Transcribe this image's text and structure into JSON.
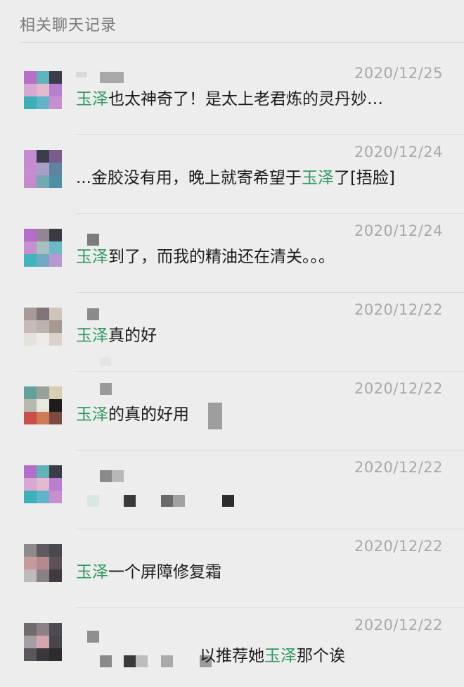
{
  "header": {
    "title": "相关聊天记录"
  },
  "colors": {
    "keyword": "#2f9a5e",
    "date": "#a8a8a8",
    "background": "#ededed"
  },
  "rows": [
    {
      "date": "2020/12/25",
      "keyword": "玉泽",
      "before": "",
      "after": "也太神奇了！是太上老君炼的灵丹妙…",
      "avatar": [
        "#b86fc7",
        "#5fb4b9",
        "#3b3b49",
        "#d7a9d2",
        "#e2b9cf",
        "#b77fcf",
        "#3bb0b6",
        "#5fb4c7",
        "#c78fd0"
      ]
    },
    {
      "date": "2020/12/24",
      "keyword": "玉泽",
      "before": "...金胶没有用，晚上就寄希望于",
      "after": "了[捂脸]",
      "avatar": [
        "#c58bd1",
        "#3b3d4a",
        "#7b5a8e",
        "#c98ad4",
        "#a99ec7",
        "#5d84a0",
        "#c68bcc",
        "#73a9b5",
        "#4f8fa4"
      ]
    },
    {
      "date": "2020/12/24",
      "keyword": "玉泽",
      "before": "",
      "after": "到了，而我的精油还在清关。。。",
      "avatar": [
        "#b46dc8",
        "#958494",
        "#3a3a45",
        "#c68fd0",
        "#a8c0c0",
        "#6fb8c9",
        "#41b4bc",
        "#73a7c6",
        "#b79ad4"
      ]
    },
    {
      "date": "2020/12/22",
      "keyword": "玉泽",
      "before": "",
      "after": "真的好",
      "avatar": [
        "#a89a94",
        "#7f7579",
        "#cfc5bc",
        "#c6bbb8",
        "#bdb3ad",
        "#a7998f",
        "#e5e1dc",
        "#eeeae6",
        "#d9d2cc"
      ]
    },
    {
      "date": "2020/12/22",
      "keyword": "玉泽",
      "before": "",
      "after": "的真的好用",
      "avatar": [
        "#61a39a",
        "#9aa09a",
        "#d6cfb0",
        "#b7b9ad",
        "#e6e8de",
        "#1d1b1c",
        "#c94f4c",
        "#ce7c55",
        "#7c4a3e"
      ]
    },
    {
      "date": "2020/12/22",
      "keyword": "",
      "before": "",
      "after": "",
      "avatar": [
        "#b46dc8",
        "#5fb4b9",
        "#3b3b49",
        "#d7a9d2",
        "#e2b9cf",
        "#b77fcf",
        "#3bb0b6",
        "#5fb4c7",
        "#c78fd0"
      ]
    },
    {
      "date": "2020/12/22",
      "keyword": "玉泽",
      "before": "",
      "after": "一个屏障修复霜",
      "avatar": [
        "#8e8a8c",
        "#5d5a61",
        "#4a4750",
        "#c59a9a",
        "#b5898b",
        "#5b5258",
        "#c0b9bb",
        "#8a7f86",
        "#3f3a40"
      ]
    },
    {
      "date": "2020/12/22",
      "keyword": "玉泽",
      "before": "以推荐她",
      "after": "那个诶",
      "avatar": [
        "#6e6a6e",
        "#8c7f86",
        "#4f4b52",
        "#a29ea3",
        "#d6a4ad",
        "#49454c",
        "#5a565b",
        "#39363c",
        "#2f2c31"
      ]
    }
  ]
}
